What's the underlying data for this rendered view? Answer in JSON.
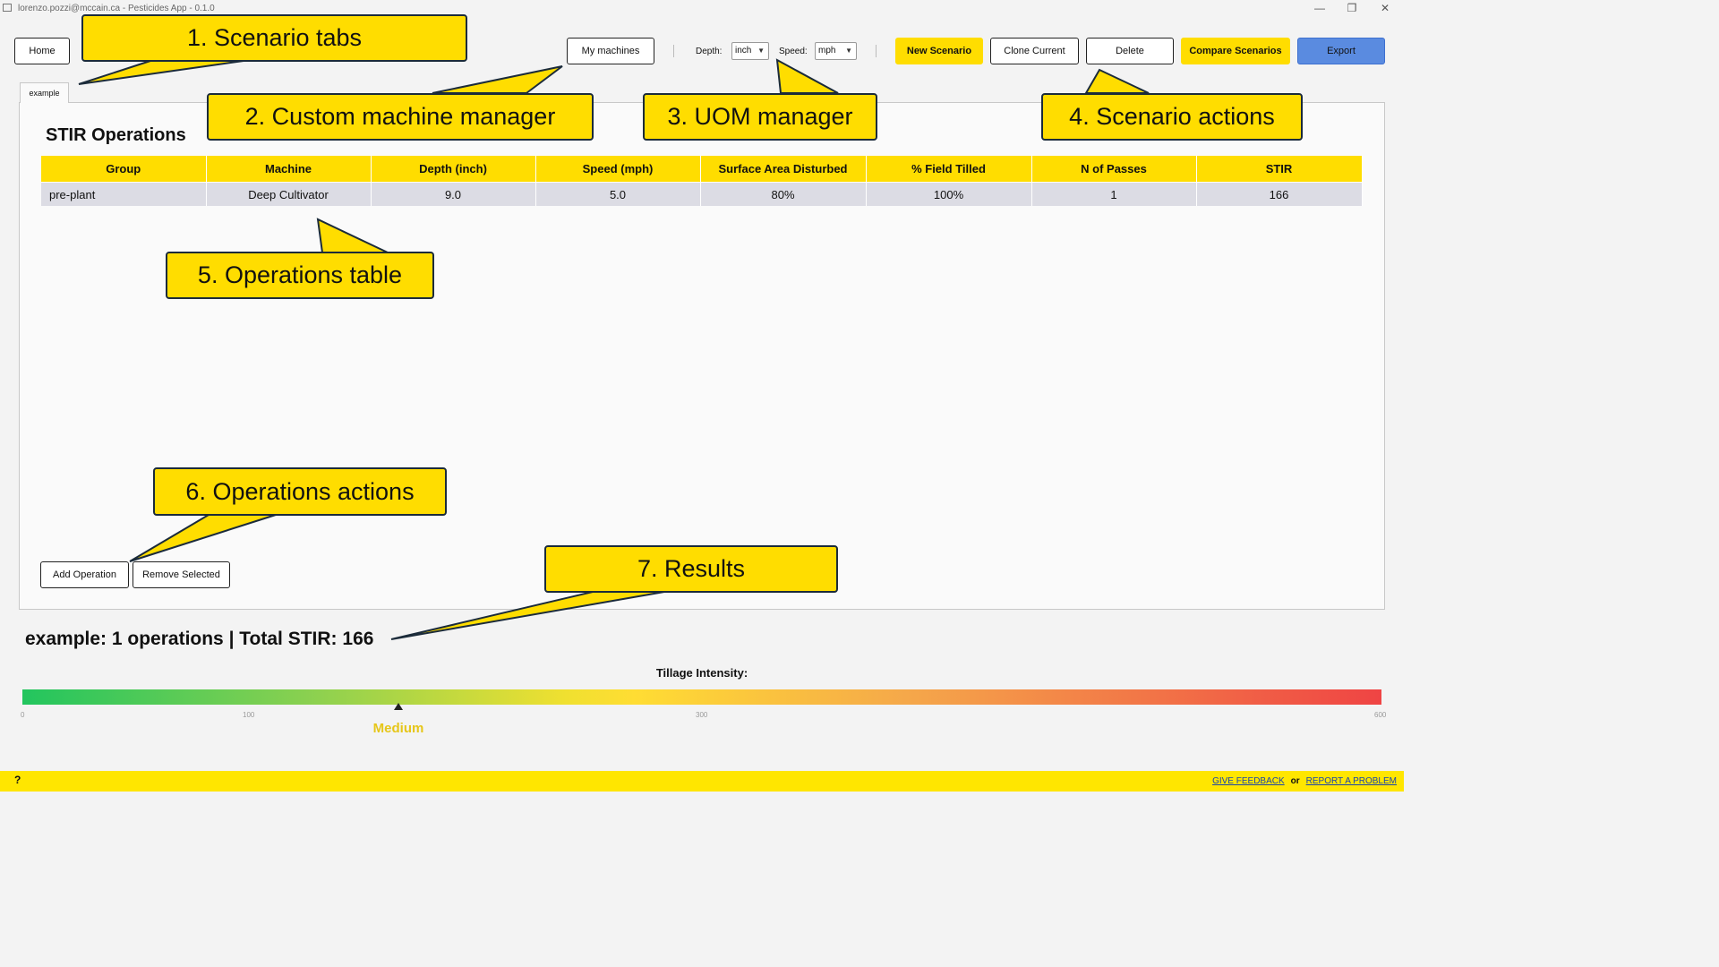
{
  "window": {
    "title": "lorenzo.pozzi@mccain.ca - Pesticides App - 0.1.0",
    "controls": [
      "—",
      "❐",
      "✕"
    ]
  },
  "toolbar": {
    "home": "Home",
    "my_machines": "My machines",
    "depth_label": "Depth:",
    "depth_value": "inch",
    "speed_label": "Speed:",
    "speed_value": "mph",
    "new_scenario": "New Scenario",
    "clone_current": "Clone Current",
    "delete": "Delete",
    "compare_scenarios": "Compare Scenarios",
    "export": "Export"
  },
  "tabs": [
    {
      "label": "example",
      "active": true
    }
  ],
  "section_title": "STIR Operations",
  "table": {
    "headers": [
      "Group",
      "Machine",
      "Depth (inch)",
      "Speed (mph)",
      "Surface Area Disturbed",
      "% Field Tilled",
      "N of Passes",
      "STIR"
    ],
    "rows": [
      [
        "pre-plant",
        "Deep Cultivator",
        "9.0",
        "5.0",
        "80%",
        "100%",
        "1",
        "166"
      ]
    ]
  },
  "operations_actions": {
    "add": "Add Operation",
    "remove": "Remove Selected"
  },
  "summary": "example: 1 operations | Total STIR: 166",
  "intensity": {
    "label": "Tillage Intensity:",
    "ticks": [
      "0",
      "100",
      "300",
      "600"
    ],
    "value": 166,
    "max": 600,
    "level": "Medium",
    "colors": {
      "low": "#22c55e",
      "mid": "#ffdd33",
      "high": "#ef4444"
    }
  },
  "footer": {
    "help": "?",
    "give_feedback": "GIVE FEEDBACK",
    "or": "or",
    "report_problem": "REPORT A PROBLEM"
  },
  "callouts": [
    "1. Scenario tabs",
    "2. Custom machine manager",
    "3. UOM manager",
    "4. Scenario actions",
    "5. Operations table",
    "6. Operations actions",
    "7. Results"
  ],
  "colors": {
    "accent_yellow": "#ffdd00",
    "export_blue": "#5a8be0",
    "row_bg": "#dcdce4",
    "callout_border": "#1b2b3a"
  }
}
